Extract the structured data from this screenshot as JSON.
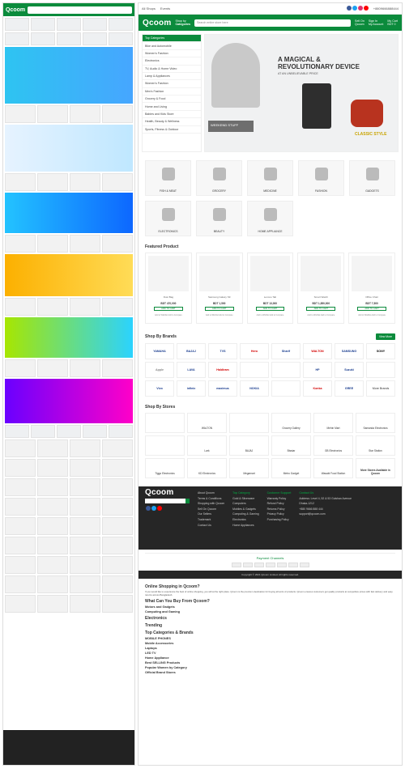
{
  "topbar": {
    "all_shops": "All Shops",
    "events": "Events",
    "phone": "+8809666888444"
  },
  "header": {
    "logo": "Qcoom",
    "shop_by": "Shop by",
    "categories": "Categories",
    "search_placeholder": "Search entire store here",
    "sell": "Sell On",
    "sell_sub": "Qcoom",
    "account": "Sign In",
    "account_sub": "My Account",
    "cart": "My Cart",
    "cart_sub": "BDT 0"
  },
  "categories": [
    "Top Categories",
    "Bike and Automobile",
    "Women's Fashion",
    "Electronics",
    "TV, Audio & Home Video",
    "Lamp & Appliances",
    "Women's Fashion",
    "Men's Fashion",
    "Grocery & Food",
    "Home and Living",
    "Babies and Kids Store",
    "Health, Beauty & Wellness",
    "Sports, Fitness & Outdoor"
  ],
  "hero": {
    "title_line1": "A MAGICAL &",
    "title_line2": "REVOLUTIONARY DEVICE",
    "subtitle": "AT AN UNBELIEVABLE PRICE",
    "promo": "WEEKEND STUFF",
    "classic": "CLASSIC STYLE"
  },
  "category_tiles": [
    "FISH & MEAT",
    "GROCERY",
    "MEDICINE",
    "FASHION",
    "GADGETS",
    "ELECTRONICS",
    "BEAUTY",
    "HOME APPLIANCE"
  ],
  "featured": {
    "title": "Featured Product",
    "items": [
      {
        "name": "Dust Bag",
        "price": "BDT 470,000",
        "btn": "ADD TO CART",
        "meta": "Add to Wishlist   Add to Compare"
      },
      {
        "name": "Samsung Galaxy S9",
        "price": "BDT 1,500",
        "btn": "ADD TO CART",
        "meta": "Add to Wishlist   Add to Compare"
      },
      {
        "name": "Lenovo Tab",
        "price": "BDT 13,000",
        "btn": "ADD TO CART",
        "meta": "Add to Wishlist   Add to Compare"
      },
      {
        "name": "Smart Watch",
        "price": "BDT 1,850,000",
        "btn": "ADD TO CART",
        "meta": "Add to Wishlist   Add to Compare"
      },
      {
        "name": "Office Chair",
        "price": "BDT 7,500",
        "btn": "ADD TO CART",
        "meta": "Add to Wishlist   Add to Compare"
      }
    ]
  },
  "brands": {
    "title": "Shop By Brands",
    "view_all": "View More",
    "list": [
      "YAMAHA",
      "BAJAJ",
      "TVS",
      "Hero",
      "Sharif",
      "WALTON",
      "SAMSUNG",
      "SONY",
      "Apple",
      "LAVA",
      "Haldiram",
      "",
      "",
      "HP",
      "Suzuki",
      "",
      "Vivo",
      "infinix",
      "maximus",
      "NOKIA",
      "",
      "Konka",
      "GREE",
      "More Brands"
    ]
  },
  "stores": {
    "title": "Shop By Stores",
    "list": [
      "",
      "WALTON",
      "",
      "Grocery Gallery",
      "Mehin Mart",
      "Samanda Electronics",
      "",
      "Lark",
      "BAJAJ",
      "Bisstar",
      "GB Electronics",
      "Star Station",
      "Tiggo Electronics",
      "KD Electronics",
      "Megamart",
      "Metro Gadget",
      "Wasabi Food Station",
      "More Stores Available in Qcoom"
    ]
  },
  "footer": {
    "about": [
      "About Qcoom",
      "Terms & Conditions",
      "Shopping with Qcoom",
      "Sell On Qcoom",
      "Our Sellers",
      "Trademark",
      "Contact Us"
    ],
    "col2_title": "Top Category",
    "col2": [
      "Gold & Silverware",
      "Computers",
      "Mobiles & Gadgets",
      "Computing & Gaming",
      "Electronics",
      "Home Appliances",
      "Home Decor & Lifestyle"
    ],
    "col3_title": "Customer Support",
    "col3": [
      "Warranty Policy",
      "Refund Policy",
      "Returns Policy",
      "Privacy Policy",
      "Purchasing Policy"
    ],
    "col4_title": "Contact Us",
    "col4": [
      "Address: Level 4, 52 & 53 Gulshan Avenue",
      "Dhaka-1212",
      "+880 9666 888 444",
      "support@qcoom.com"
    ],
    "payment_title": "Payment Channels",
    "copyright": "Copyright © 2021 Qcoom Limited. All rights reserved."
  },
  "article": {
    "h1": "Online Shopping in Qcoom?",
    "p1": "If you would like to experience the best of online shopping, you will at the right place. Qcoom is the premium destination for buying all sorts of products. Qcoom ensures customers get quality products at competitive prices with fast delivery and easy returns across Bangladesh.",
    "h2": "What Can You Buy From Qcoom?",
    "h3": "Motors and Gadgets",
    "h4": "Computing and Gaming",
    "h5": "Electronics",
    "h6": "Trending",
    "h7": "Top Categories & Brands",
    "sub1": "MOBILE PHONES",
    "sub2": "Mobile Accessories",
    "sub3": "Laptops",
    "sub4": "LED TV",
    "sub5": "Home Appliance",
    "sub6": "Best SELLING Products",
    "sub7": "Popular Women by Category",
    "sub8": "Official Brand Stores"
  }
}
